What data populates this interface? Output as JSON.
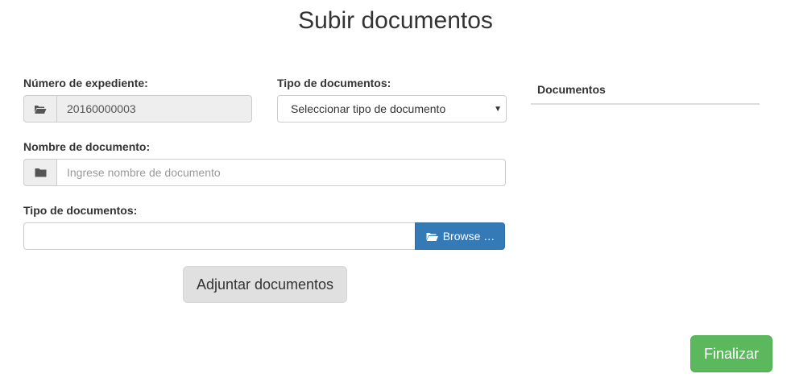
{
  "page": {
    "title": "Subir documentos"
  },
  "form": {
    "expediente": {
      "label": "Número de expediente:",
      "value": "20160000003",
      "icon": "folder-open-icon"
    },
    "tipo_documentos": {
      "label": "Tipo de documentos:",
      "selected": "Seleccionar tipo de documento"
    },
    "nombre_documento": {
      "label": "Nombre de documento:",
      "placeholder": "Ingrese nombre de documento",
      "icon": "folder-icon"
    },
    "archivo": {
      "label": "Tipo de documentos:",
      "browse_label": "Browse …",
      "icon": "folder-open-icon"
    },
    "attach_label": "Adjuntar documentos"
  },
  "documents_panel": {
    "title": "Documentos"
  },
  "actions": {
    "finish_label": "Finalizar"
  },
  "colors": {
    "primary": "#337ab7",
    "success": "#5cb85c",
    "default": "#e0e0e0"
  }
}
